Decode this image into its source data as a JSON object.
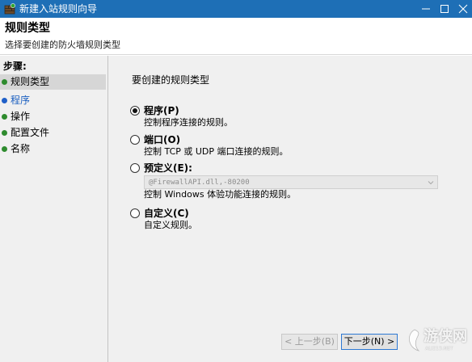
{
  "window": {
    "title": "新建入站规则向导",
    "titlebar_color": "#1e6fb6"
  },
  "header": {
    "title": "规则类型",
    "subtitle": "选择要创建的防火墙规则类型"
  },
  "steps": {
    "heading": "步骤:",
    "items": [
      {
        "label": "规则类型",
        "state": "done",
        "dot_color": "#2e8b2e"
      },
      {
        "label": "程序",
        "state": "current",
        "dot_color": "#2060c8"
      },
      {
        "label": "操作",
        "state": "pending",
        "dot_color": "#2e8b2e"
      },
      {
        "label": "配置文件",
        "state": "pending",
        "dot_color": "#2e8b2e"
      },
      {
        "label": "名称",
        "state": "pending",
        "dot_color": "#2e8b2e"
      }
    ]
  },
  "main": {
    "question": "要创建的规则类型",
    "options": [
      {
        "label": "程序(P)",
        "description": "控制程序连接的规则。",
        "selected": true
      },
      {
        "label": "端口(O)",
        "description": "控制 TCP 或 UDP 端口连接的规则。",
        "selected": false
      },
      {
        "label": "预定义(E):",
        "description": "控制 Windows 体验功能连接的规则。",
        "selected": false,
        "dropdown_value": "@FirewallAPI.dll,-80200"
      },
      {
        "label": "自定义(C)",
        "description": "自定义规则。",
        "selected": false
      }
    ]
  },
  "buttons": {
    "back": "< 上一步(B)",
    "next": "下一步(N) >"
  },
  "watermark": {
    "text": "游侠网",
    "sub": "ALI213.NET"
  }
}
